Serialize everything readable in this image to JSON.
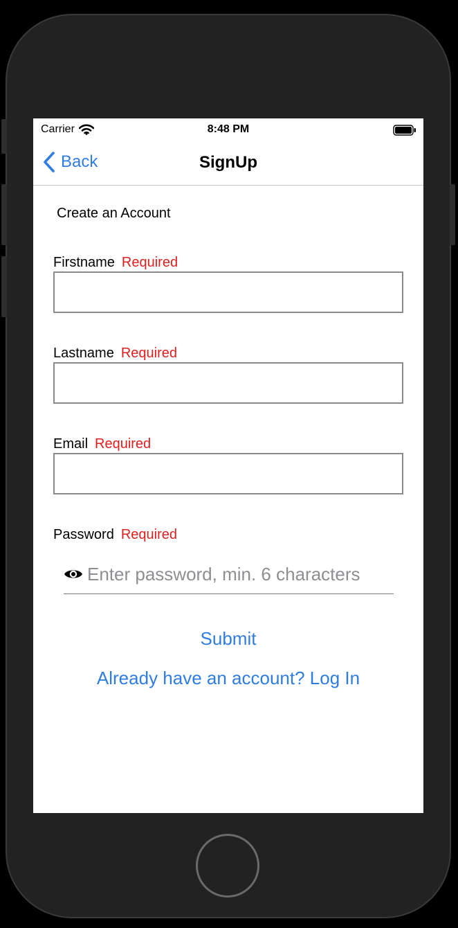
{
  "status_bar": {
    "carrier": "Carrier",
    "time": "8:48 PM"
  },
  "nav": {
    "back_label": "Back",
    "title": "SignUp"
  },
  "form": {
    "heading": "Create an Account",
    "required_text": "Required",
    "fields": [
      {
        "label": "Firstname",
        "value": "",
        "placeholder": ""
      },
      {
        "label": "Lastname",
        "value": "",
        "placeholder": ""
      },
      {
        "label": "Email",
        "value": "",
        "placeholder": ""
      }
    ],
    "password": {
      "label": "Password",
      "placeholder": "Enter password, min. 6 characters",
      "value": ""
    }
  },
  "actions": {
    "submit_label": "Submit",
    "login_link_label": "Already have an account? Log In"
  },
  "icons": {
    "back": "chevron-left-icon",
    "wifi": "wifi-icon",
    "battery": "battery-icon",
    "eye": "eye-icon"
  },
  "colors": {
    "accent": "#2f7de1",
    "required": "#e01e1e",
    "frame": "#222222"
  }
}
